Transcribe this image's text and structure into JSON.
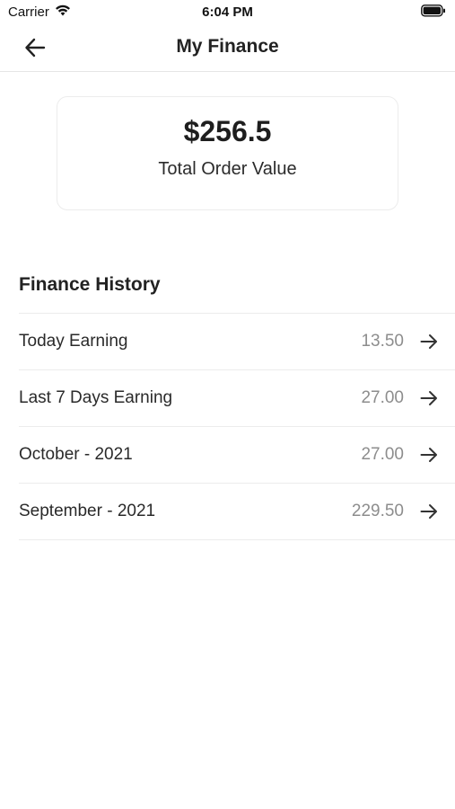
{
  "status_bar": {
    "carrier": "Carrier",
    "time": "6:04 PM",
    "wifi_icon": "wifi-icon",
    "battery_icon": "battery-icon"
  },
  "nav": {
    "title": "My Finance",
    "back_icon": "back-arrow-icon"
  },
  "summary": {
    "amount": "$256.5",
    "label": "Total Order Value"
  },
  "history": {
    "title": "Finance History",
    "rows": [
      {
        "label": "Today Earning",
        "value": "13.50"
      },
      {
        "label": "Last 7 Days Earning",
        "value": "27.00"
      },
      {
        "label": "October - 2021",
        "value": "27.00"
      },
      {
        "label": "September - 2021",
        "value": "229.50"
      }
    ],
    "row_icon": "arrow-right-icon"
  },
  "colors": {
    "text": "#222222",
    "muted": "#8d8d8d",
    "divider": "#ececec"
  }
}
